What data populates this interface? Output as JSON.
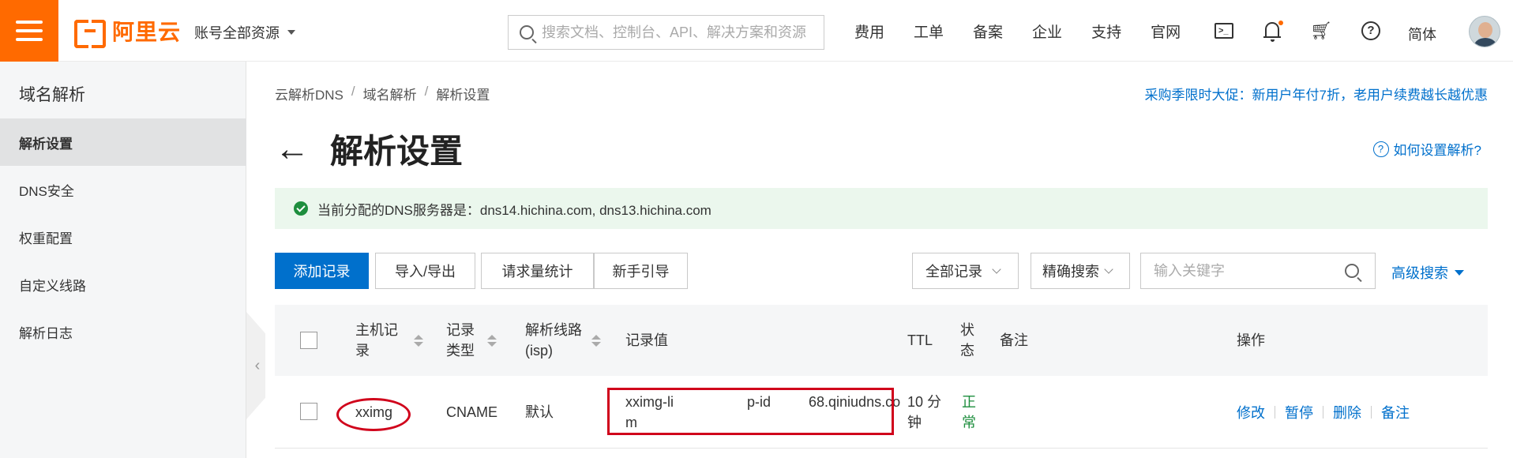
{
  "header": {
    "logo_text": "阿里云",
    "account_label": "账号全部资源",
    "search_placeholder": "搜索文档、控制台、API、解决方案和资源",
    "nav": [
      "费用",
      "工单",
      "备案",
      "企业",
      "支持",
      "官网"
    ],
    "icons": [
      "terminal-icon",
      "bell-icon",
      "cart-icon",
      "help-icon"
    ],
    "lang": "简体",
    "accent": "#ff6a00"
  },
  "sidebar": {
    "title": "域名解析",
    "items": [
      {
        "label": "解析设置",
        "active": true
      },
      {
        "label": "DNS安全",
        "active": false
      },
      {
        "label": "权重配置",
        "active": false
      },
      {
        "label": "自定义线路",
        "active": false
      },
      {
        "label": "解析日志",
        "active": false
      }
    ]
  },
  "main": {
    "breadcrumb": [
      "云解析DNS",
      "域名解析",
      "解析设置"
    ],
    "promo": "采购季限时大促：新用户年付7折，老用户续费越长越优惠",
    "title": "解析设置",
    "help_link": "如何设置解析?",
    "notice": "当前分配的DNS服务器是：dns14.hichina.com, dns13.hichina.com",
    "toolbar": {
      "add": "添加记录",
      "import_export": "导入/导出",
      "stats": "请求量统计",
      "guide": "新手引导",
      "filter_all": "全部记录",
      "search_mode": "精确搜索",
      "keyword_placeholder": "输入关键字",
      "advanced": "高级搜索"
    },
    "table": {
      "columns": {
        "host_1": "主机记",
        "host_2": "录",
        "type_1": "记录",
        "type_2": "类型",
        "line_1": "解析线路",
        "line_2": "(isp)",
        "value": "记录值",
        "ttl": "TTL",
        "status_1": "状",
        "status_2": "态",
        "remark": "备注",
        "ops": "操作"
      },
      "rows": [
        {
          "host": "xximg",
          "type": "CNAME",
          "line": "默认",
          "value_1": "xximg-li",
          "value_2": "p-id",
          "value_3": "68.qiniudns.co",
          "value_4": "m",
          "ttl_1": "10 分",
          "ttl_2": "钟",
          "status_1": "正",
          "status_2": "常",
          "ops": [
            "修改",
            "暂停",
            "删除",
            "备注"
          ]
        }
      ]
    }
  }
}
